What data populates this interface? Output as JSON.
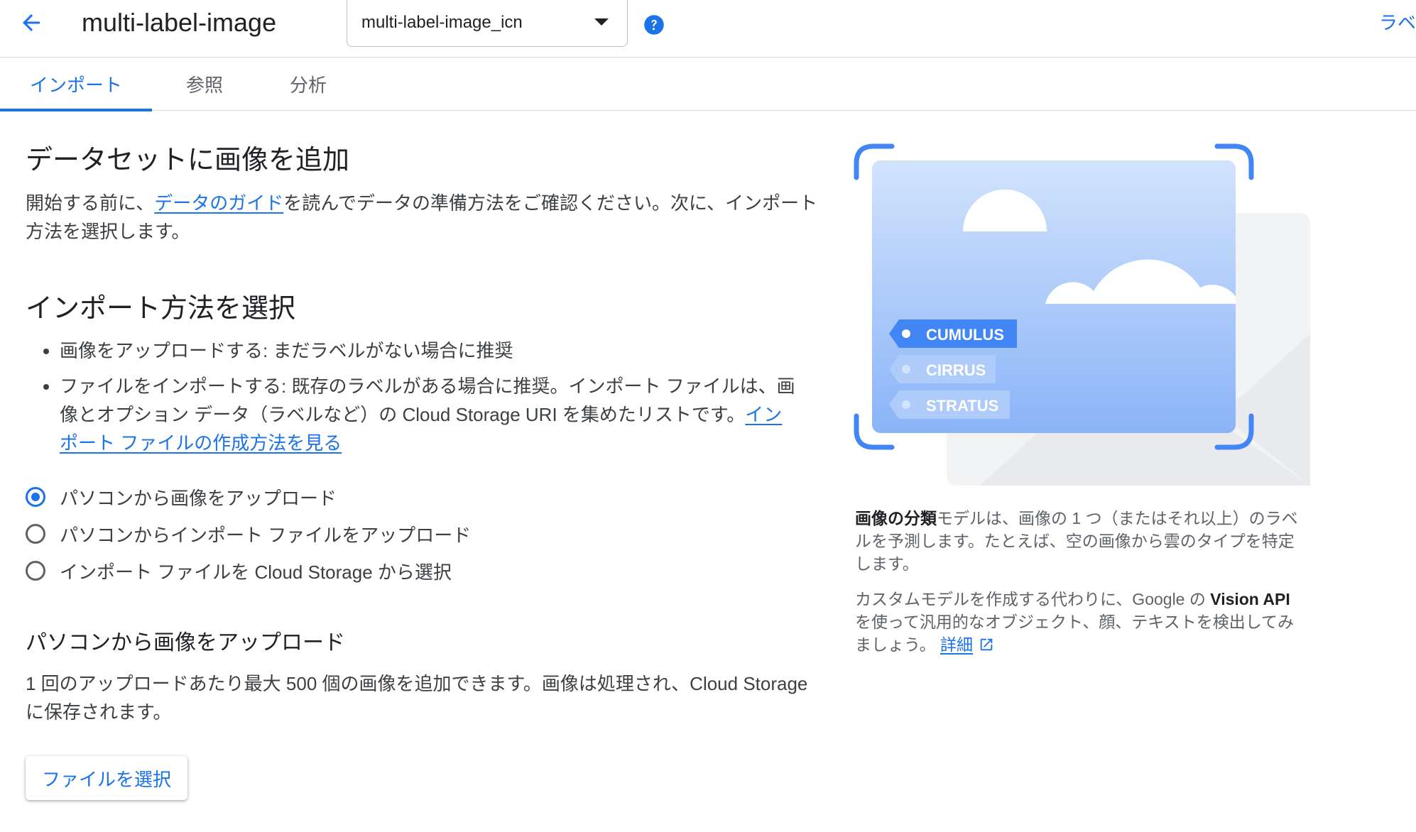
{
  "header": {
    "title": "multi-label-image",
    "dataset_select_value": "multi-label-image_icn",
    "top_right_link": "ラベ"
  },
  "tabs": [
    {
      "label": "インポート",
      "active": true
    },
    {
      "label": "参照",
      "active": false
    },
    {
      "label": "分析",
      "active": false
    }
  ],
  "add_images": {
    "heading": "データセットに画像を追加",
    "intro_before": "開始する前に、",
    "intro_link": "データのガイド",
    "intro_after": "を読んでデータの準備方法をご確認ください。次に、インポート方法を選択します。"
  },
  "import_method": {
    "heading": "インポート方法を選択",
    "bullet1": "画像をアップロードする: まだラベルがない場合に推奨",
    "bullet2": "ファイルをインポートする: 既存のラベルがある場合に推奨。インポート ファイルは、画像とオプション データ（ラベルなど）の Cloud Storage URI を集めたリストです。",
    "bullet2_link": "インポート ファイルの作成方法を見る",
    "options": [
      {
        "label": "パソコンから画像をアップロード",
        "checked": true
      },
      {
        "label": "パソコンからインポート ファイルをアップロード",
        "checked": false
      },
      {
        "label": "インポート ファイルを Cloud Storage から選択",
        "checked": false
      }
    ]
  },
  "upload": {
    "heading": "パソコンから画像をアップロード",
    "description": "1 回のアップロードあたり最大 500 個の画像を追加できます。画像は処理され、Cloud Storage に保存されます。",
    "button_label": "ファイルを選択"
  },
  "illustration": {
    "tags": [
      "CUMULUS",
      "CIRRUS",
      "STRATUS"
    ]
  },
  "side": {
    "p1_bold": "画像の分類",
    "p1_rest": "モデルは、画像の 1 つ（またはそれ以上）のラベルを予測します。たとえば、空の画像から雲のタイプを特定します。",
    "p2_before": "カスタムモデルを作成する代わりに、Google の ",
    "p2_bold": "Vision API",
    "p2_after": " を使って汎用的なオブジェクト、顔、テキストを検出してみましょう。",
    "p2_link": "詳細"
  },
  "colors": {
    "accent": "#1a73e8",
    "illustration_sky": "#d2e3fc",
    "illustration_tag": "#4285f4"
  }
}
